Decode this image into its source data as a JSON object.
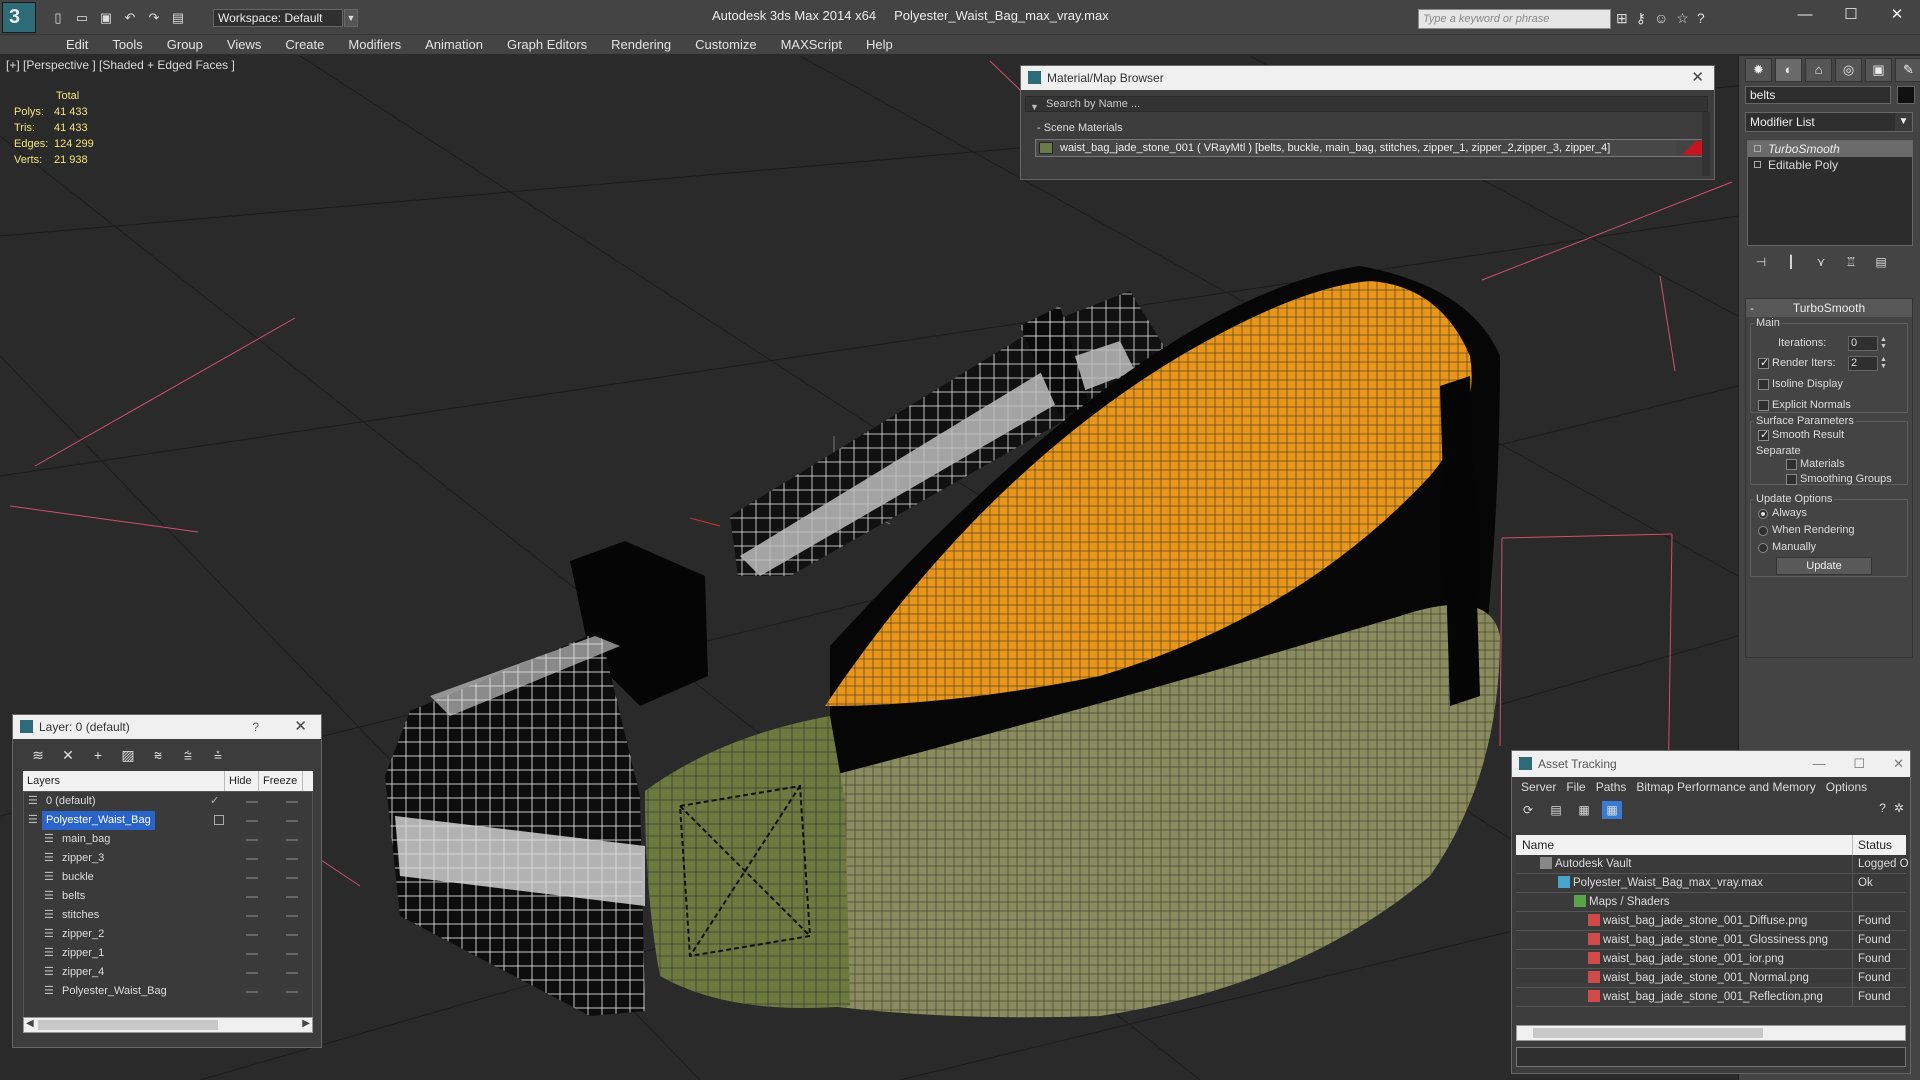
{
  "window": {
    "app_title": "Autodesk 3ds Max  2014 x64",
    "file_title": "Polyester_Waist_Bag_max_vray.max",
    "workspace": "Workspace: Default",
    "search_placeholder": "Type a keyword or phrase"
  },
  "menu": [
    "Edit",
    "Tools",
    "Group",
    "Views",
    "Create",
    "Modifiers",
    "Animation",
    "Graph Editors",
    "Rendering",
    "Customize",
    "MAXScript",
    "Help"
  ],
  "viewport": {
    "label": "[+] [Perspective ] [Shaded + Edged Faces ]",
    "stats": {
      "header": "Total",
      "rows": [
        {
          "k": "Polys:",
          "v": "41 433"
        },
        {
          "k": "Tris:",
          "v": "41 433"
        },
        {
          "k": "Edges:",
          "v": "124 299"
        },
        {
          "k": "Verts:",
          "v": "21 938"
        }
      ]
    }
  },
  "material_browser": {
    "title": "Material/Map Browser",
    "search_placeholder": "Search by Name ...",
    "section": "- Scene Materials",
    "material": "waist_bag_jade_stone_001  ( VRayMtl ) [belts, buckle, main_bag, stitches, zipper_1, zipper_2,zipper_3, zipper_4]"
  },
  "command_panel": {
    "object_name": "belts",
    "modifier_list": "Modifier List",
    "stack": [
      "TurboSmooth",
      "Editable Poly"
    ],
    "rollout_title": "TurboSmooth",
    "main_label": "Main",
    "iterations_label": "Iterations:",
    "iterations_value": "0",
    "render_iters_label": "Render Iters:",
    "render_iters_value": "2",
    "isoline": "Isoline Display",
    "explicit_normals": "Explicit Normals",
    "surface_params": "Surface Parameters",
    "smooth_result": "Smooth Result",
    "separate": "Separate",
    "materials": "Materials",
    "smoothing_groups": "Smoothing Groups",
    "update_options": "Update Options",
    "always": "Always",
    "when_rendering": "When Rendering",
    "manually": "Manually",
    "update_button": "Update"
  },
  "layer_window": {
    "title": "Layer: 0 (default)",
    "help": "?",
    "columns": {
      "layers": "Layers",
      "hide": "Hide",
      "freeze": "Freeze"
    },
    "rows": [
      "0 (default)",
      "Polyester_Waist_Bag",
      "main_bag",
      "zipper_3",
      "buckle",
      "belts",
      "stitches",
      "zipper_2",
      "zipper_1",
      "zipper_4",
      "Polyester_Waist_Bag"
    ]
  },
  "asset_tracking": {
    "title": "Asset Tracking",
    "menu": [
      "Server",
      "File",
      "Paths",
      "Bitmap Performance and Memory",
      "Options"
    ],
    "columns": {
      "name": "Name",
      "status": "Status"
    },
    "rows": [
      {
        "name": "Autodesk Vault",
        "status": "Logged Ou"
      },
      {
        "name": "Polyester_Waist_Bag_max_vray.max",
        "status": "Ok"
      },
      {
        "name": "Maps / Shaders",
        "status": ""
      },
      {
        "name": "waist_bag_jade_stone_001_Diffuse.png",
        "status": "Found"
      },
      {
        "name": "waist_bag_jade_stone_001_Glossiness.png",
        "status": "Found"
      },
      {
        "name": "waist_bag_jade_stone_001_ior.png",
        "status": "Found"
      },
      {
        "name": "waist_bag_jade_stone_001_Normal.png",
        "status": "Found"
      },
      {
        "name": "waist_bag_jade_stone_001_Reflection.png",
        "status": "Found"
      }
    ]
  },
  "colors": {
    "viewport_bg": "#2a2a2a",
    "orange_panel": "#e8951a",
    "olive_panel": "#8a8b5e",
    "green_patch": "#6c7a40",
    "selection_blue": "#2a64c8"
  }
}
